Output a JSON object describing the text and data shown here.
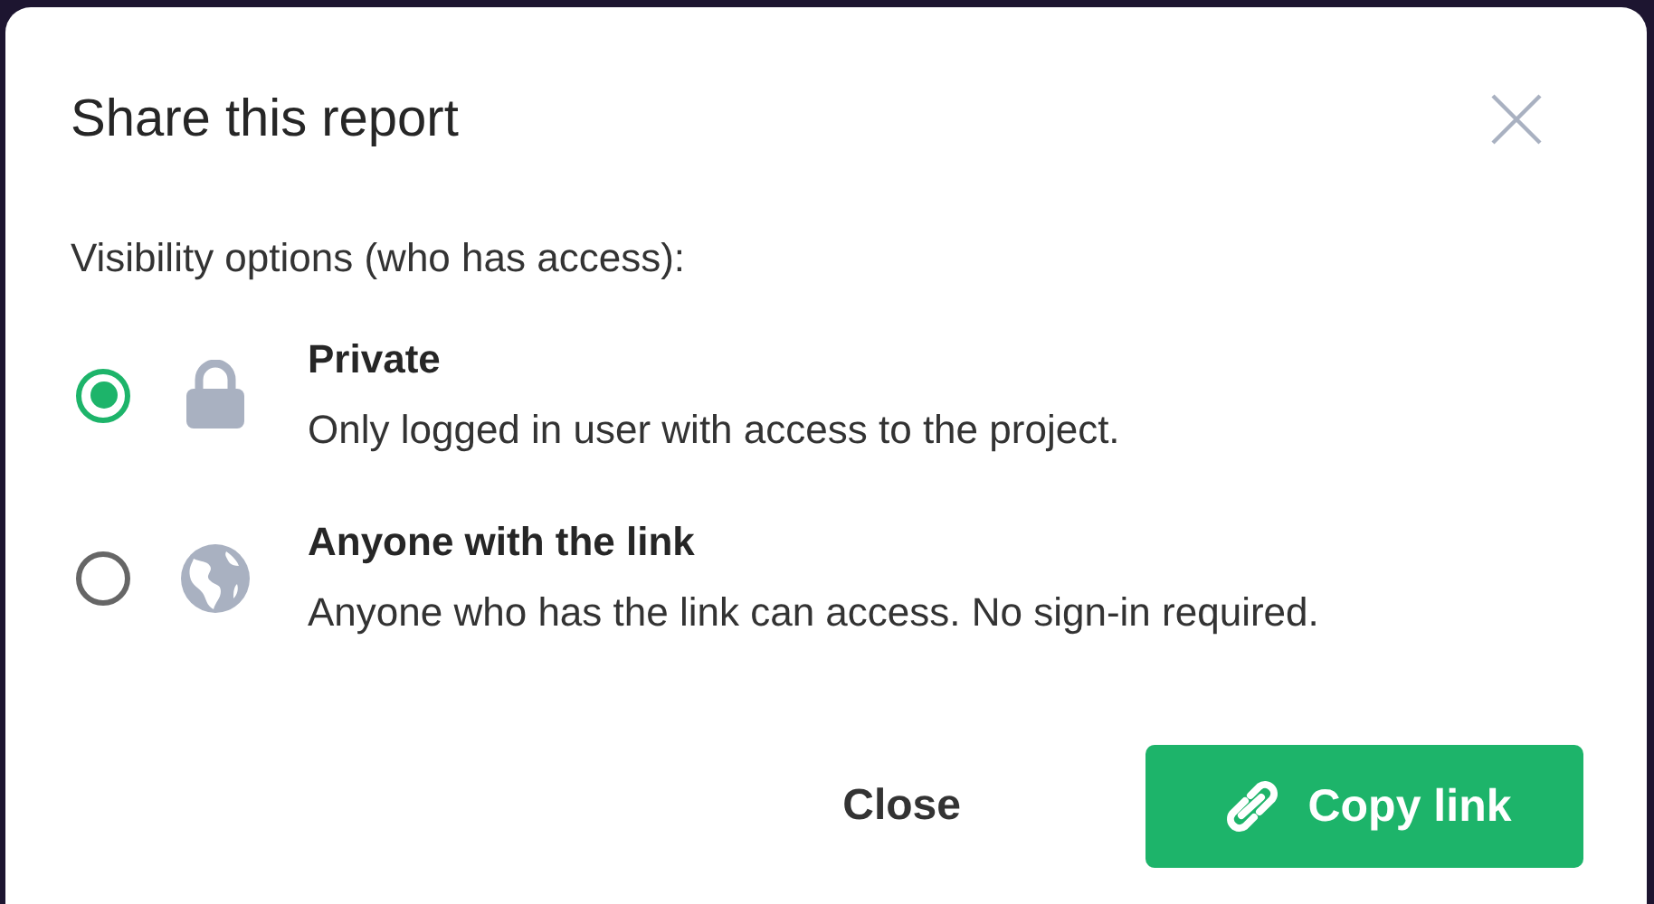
{
  "dialog": {
    "title": "Share this report",
    "prompt": "Visibility options (who has access):",
    "options": [
      {
        "kind": "lock",
        "title": "Private",
        "description": "Only logged in user with access to the project.",
        "selected": true
      },
      {
        "kind": "globe",
        "title": "Anyone with the link",
        "description": "Anyone who has the link can access. No sign-in required.",
        "selected": false
      }
    ],
    "buttons": [
      {
        "kind": "plain",
        "label": "Close"
      },
      {
        "kind": "primary",
        "label": "Copy link"
      }
    ]
  }
}
